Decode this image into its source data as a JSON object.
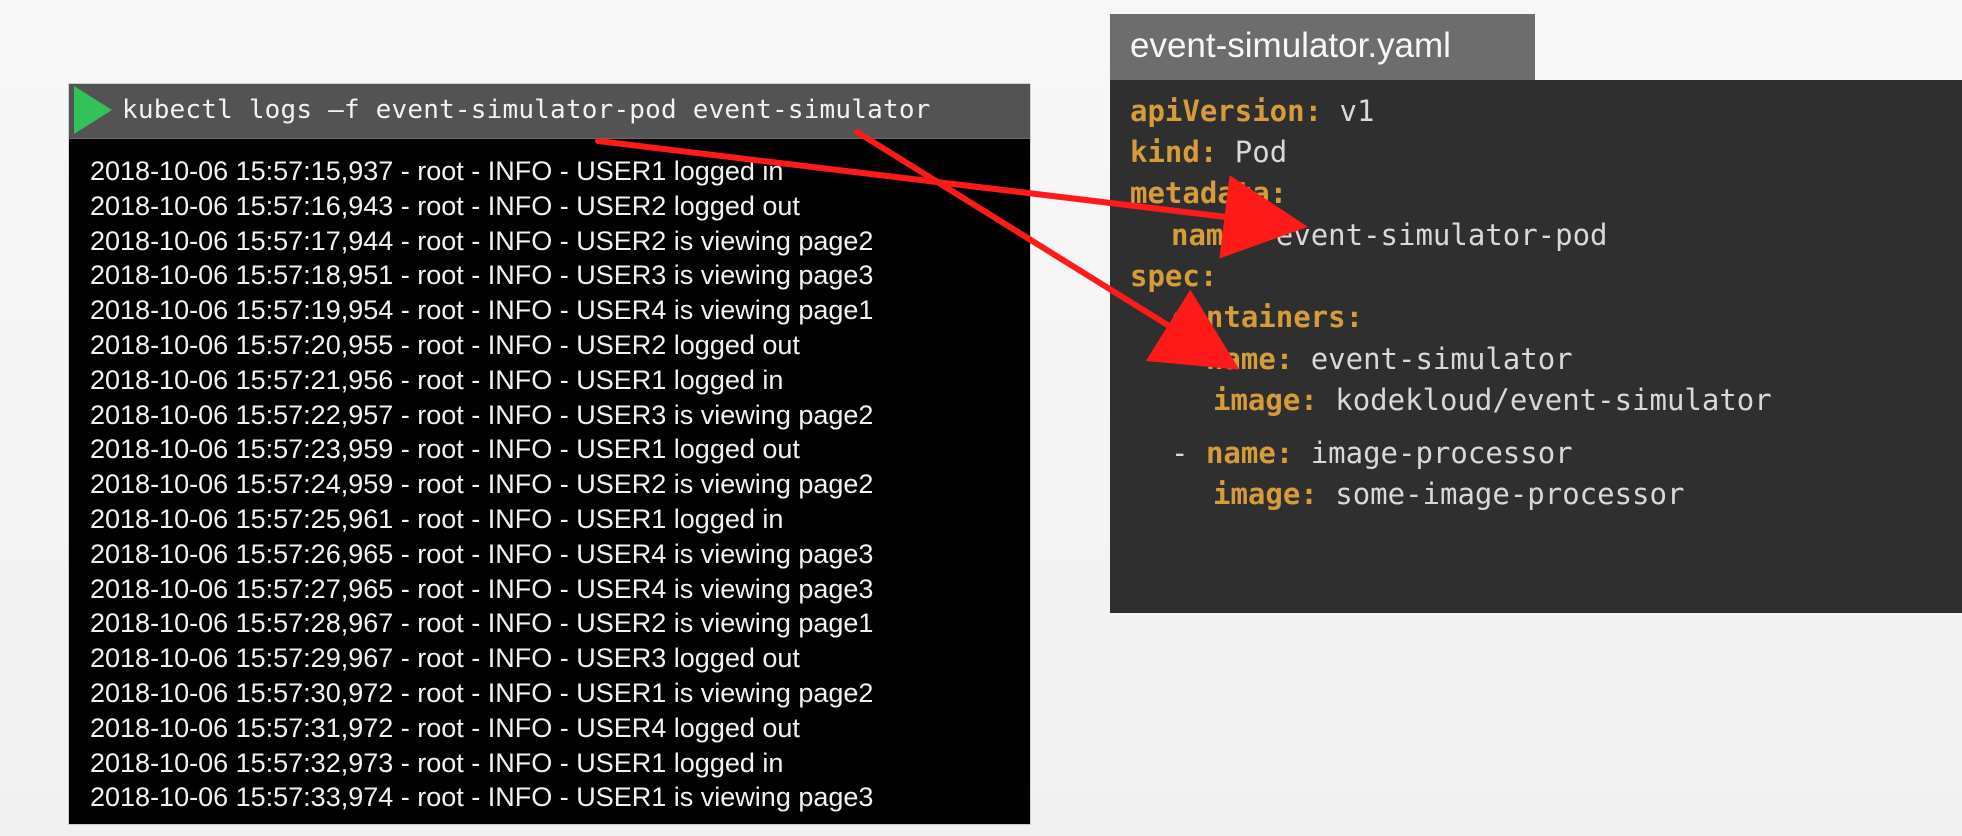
{
  "terminal": {
    "command": "kubectl logs –f event-simulator-pod event-simulator",
    "play_icon": "play-icon",
    "logs": [
      "2018-10-06 15:57:15,937 - root - INFO - USER1 logged in",
      "2018-10-06 15:57:16,943 - root - INFO - USER2 logged out",
      "2018-10-06 15:57:17,944 - root - INFO - USER2 is viewing page2",
      "2018-10-06 15:57:18,951 - root - INFO - USER3 is viewing page3",
      "2018-10-06 15:57:19,954 - root - INFO - USER4 is viewing page1",
      "2018-10-06 15:57:20,955 - root - INFO - USER2 logged out",
      "2018-10-06 15:57:21,956 - root - INFO - USER1 logged in",
      "2018-10-06 15:57:22,957 - root - INFO - USER3 is viewing page2",
      "2018-10-06 15:57:23,959 - root - INFO - USER1 logged out",
      "2018-10-06 15:57:24,959 - root - INFO - USER2 is viewing page2",
      "2018-10-06 15:57:25,961 - root - INFO - USER1 logged in",
      "2018-10-06 15:57:26,965 - root - INFO - USER4 is viewing page3",
      "2018-10-06 15:57:27,965 - root - INFO - USER4 is viewing page3",
      "2018-10-06 15:57:28,967 - root - INFO - USER2 is viewing page1",
      "2018-10-06 15:57:29,967 - root - INFO - USER3 logged out",
      "2018-10-06 15:57:30,972 - root - INFO - USER1 is viewing page2",
      "2018-10-06 15:57:31,972 - root - INFO - USER4 logged out",
      "2018-10-06 15:57:32,973 - root - INFO - USER1 logged in",
      "2018-10-06 15:57:33,974 - root - INFO - USER1 is viewing page3"
    ]
  },
  "yaml": {
    "file_name": "event-simulator.yaml",
    "line1_key": "apiVersion:",
    "line1_value": "v1",
    "line2_key": "kind:",
    "line2_value": "Pod",
    "line3_key": "metadata:",
    "line4_key": "name:",
    "line4_value": "event-simulator-pod",
    "line5_key": "spec:",
    "line6_key": "containers:",
    "line7_dash": "-",
    "line7_key": "name:",
    "line7_value": "event-simulator",
    "line8_key": "image:",
    "line8_value": "kodekloud/event-simulator",
    "line9_dash": "-",
    "line9_key": "name:",
    "line9_value": "image-processor",
    "line10_key": "image:",
    "line10_value": "some-image-processor"
  },
  "colors": {
    "terminal_bg": "#000000",
    "terminal_header": "#535353",
    "yaml_bg": "#2f2f2f",
    "yaml_tab": "#6d6d6d",
    "yaml_key": "#d69b3a",
    "yaml_value": "#d8d8d8",
    "arrow": "#ff1a1a",
    "play_icon": "#33c15a"
  }
}
